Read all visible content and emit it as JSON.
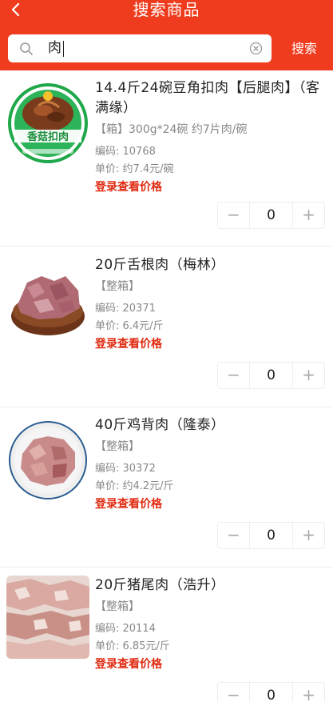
{
  "header": {
    "title": "搜索商品",
    "background": "#f03c1e"
  },
  "search": {
    "value": "肉",
    "button_label": "搜索"
  },
  "products": [
    {
      "name": "14.4斤24碗豆角扣肉【后腿肉】（客满缘）",
      "spec": "【箱】300g*24碗 约7片肉/碗",
      "code": "编码: 10768",
      "price": "单价:  约7.4元/碗",
      "login_prompt": "登录查看价格",
      "quantity": "0",
      "image_text": "香菇扣肉"
    },
    {
      "name": "20斤舌根肉（梅林）",
      "spec": "【整箱】",
      "code": "编码: 20371",
      "price": "单价:  6.4元/斤",
      "login_prompt": "登录查看价格",
      "quantity": "0"
    },
    {
      "name": "40斤鸡背肉（隆泰）",
      "spec": "【整箱】",
      "code": "编码: 30372",
      "price": "单价:  约4.2元/斤",
      "login_prompt": "登录查看价格",
      "quantity": "0"
    },
    {
      "name": "20斤猪尾肉（浩升）",
      "spec": "【整箱】",
      "code": "编码: 20114",
      "price": "单价:  6.85元/斤",
      "login_prompt": "登录查看价格",
      "quantity": "0"
    }
  ],
  "stepper": {
    "minus": "−",
    "plus": "+"
  },
  "colors": {
    "accent": "#f03c1e",
    "login_price": "#e02a10"
  }
}
